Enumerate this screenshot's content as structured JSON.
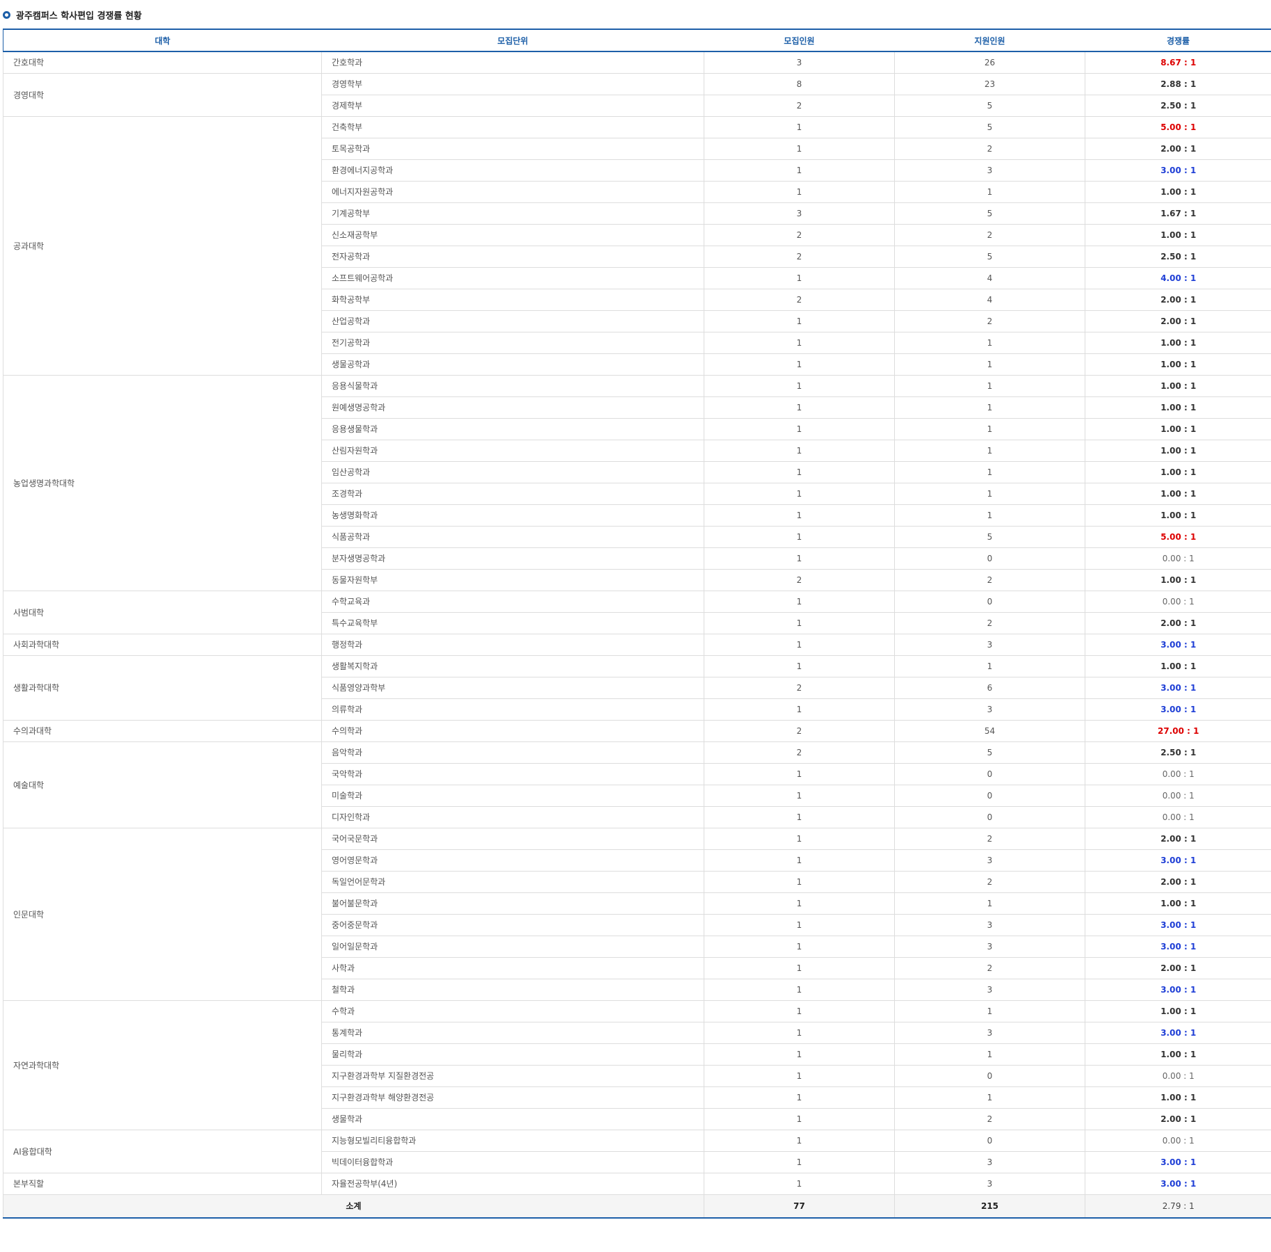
{
  "title": "광주캠퍼스 학사편입 경쟁률 현황",
  "headers": [
    "대학",
    "모집단위",
    "모집인원",
    "지원인원",
    "경쟁률"
  ],
  "colors": {
    "accent": "#1d5fa8",
    "high": "#dd0000",
    "mid": "#1f3fd6"
  },
  "groups": [
    {
      "college": "간호대학",
      "rows": [
        {
          "unit": "간호학과",
          "quota": "3",
          "applicants": "26",
          "rate": "8.67 : 1",
          "tone": "red"
        }
      ]
    },
    {
      "college": "경영대학",
      "rows": [
        {
          "unit": "경영학부",
          "quota": "8",
          "applicants": "23",
          "rate": "2.88 : 1",
          "tone": "normal"
        },
        {
          "unit": "경제학부",
          "quota": "2",
          "applicants": "5",
          "rate": "2.50 : 1",
          "tone": "normal"
        }
      ]
    },
    {
      "college": "공과대학",
      "rows": [
        {
          "unit": "건축학부",
          "quota": "1",
          "applicants": "5",
          "rate": "5.00 : 1",
          "tone": "red"
        },
        {
          "unit": "토목공학과",
          "quota": "1",
          "applicants": "2",
          "rate": "2.00 : 1",
          "tone": "normal"
        },
        {
          "unit": "환경에너지공학과",
          "quota": "1",
          "applicants": "3",
          "rate": "3.00 : 1",
          "tone": "blue"
        },
        {
          "unit": "에너지자원공학과",
          "quota": "1",
          "applicants": "1",
          "rate": "1.00 : 1",
          "tone": "normal"
        },
        {
          "unit": "기계공학부",
          "quota": "3",
          "applicants": "5",
          "rate": "1.67 : 1",
          "tone": "normal"
        },
        {
          "unit": "신소재공학부",
          "quota": "2",
          "applicants": "2",
          "rate": "1.00 : 1",
          "tone": "normal"
        },
        {
          "unit": "전자공학과",
          "quota": "2",
          "applicants": "5",
          "rate": "2.50 : 1",
          "tone": "normal"
        },
        {
          "unit": "소프트웨어공학과",
          "quota": "1",
          "applicants": "4",
          "rate": "4.00 : 1",
          "tone": "blue"
        },
        {
          "unit": "화학공학부",
          "quota": "2",
          "applicants": "4",
          "rate": "2.00 : 1",
          "tone": "normal"
        },
        {
          "unit": "산업공학과",
          "quota": "1",
          "applicants": "2",
          "rate": "2.00 : 1",
          "tone": "normal"
        },
        {
          "unit": "전기공학과",
          "quota": "1",
          "applicants": "1",
          "rate": "1.00 : 1",
          "tone": "normal"
        },
        {
          "unit": "생물공학과",
          "quota": "1",
          "applicants": "1",
          "rate": "1.00 : 1",
          "tone": "normal"
        }
      ]
    },
    {
      "college": "농업생명과학대학",
      "rows": [
        {
          "unit": "응용식물학과",
          "quota": "1",
          "applicants": "1",
          "rate": "1.00 : 1",
          "tone": "normal"
        },
        {
          "unit": "원예생명공학과",
          "quota": "1",
          "applicants": "1",
          "rate": "1.00 : 1",
          "tone": "normal"
        },
        {
          "unit": "응용생물학과",
          "quota": "1",
          "applicants": "1",
          "rate": "1.00 : 1",
          "tone": "normal"
        },
        {
          "unit": "산림자원학과",
          "quota": "1",
          "applicants": "1",
          "rate": "1.00 : 1",
          "tone": "normal"
        },
        {
          "unit": "임산공학과",
          "quota": "1",
          "applicants": "1",
          "rate": "1.00 : 1",
          "tone": "normal"
        },
        {
          "unit": "조경학과",
          "quota": "1",
          "applicants": "1",
          "rate": "1.00 : 1",
          "tone": "normal"
        },
        {
          "unit": "농생명화학과",
          "quota": "1",
          "applicants": "1",
          "rate": "1.00 : 1",
          "tone": "normal"
        },
        {
          "unit": "식품공학과",
          "quota": "1",
          "applicants": "5",
          "rate": "5.00 : 1",
          "tone": "red"
        },
        {
          "unit": "분자생명공학과",
          "quota": "1",
          "applicants": "0",
          "rate": "0.00 : 1",
          "tone": "zero"
        },
        {
          "unit": "동물자원학부",
          "quota": "2",
          "applicants": "2",
          "rate": "1.00 : 1",
          "tone": "normal"
        }
      ]
    },
    {
      "college": "사범대학",
      "rows": [
        {
          "unit": "수학교육과",
          "quota": "1",
          "applicants": "0",
          "rate": "0.00 : 1",
          "tone": "zero"
        },
        {
          "unit": "특수교육학부",
          "quota": "1",
          "applicants": "2",
          "rate": "2.00 : 1",
          "tone": "normal"
        }
      ]
    },
    {
      "college": "사회과학대학",
      "rows": [
        {
          "unit": "행정학과",
          "quota": "1",
          "applicants": "3",
          "rate": "3.00 : 1",
          "tone": "blue"
        }
      ]
    },
    {
      "college": "생활과학대학",
      "rows": [
        {
          "unit": "생활복지학과",
          "quota": "1",
          "applicants": "1",
          "rate": "1.00 : 1",
          "tone": "normal"
        },
        {
          "unit": "식품영양과학부",
          "quota": "2",
          "applicants": "6",
          "rate": "3.00 : 1",
          "tone": "blue"
        },
        {
          "unit": "의류학과",
          "quota": "1",
          "applicants": "3",
          "rate": "3.00 : 1",
          "tone": "blue"
        }
      ]
    },
    {
      "college": "수의과대학",
      "rows": [
        {
          "unit": "수의학과",
          "quota": "2",
          "applicants": "54",
          "rate": "27.00 : 1",
          "tone": "red"
        }
      ]
    },
    {
      "college": "예술대학",
      "rows": [
        {
          "unit": "음악학과",
          "quota": "2",
          "applicants": "5",
          "rate": "2.50 : 1",
          "tone": "normal"
        },
        {
          "unit": "국악학과",
          "quota": "1",
          "applicants": "0",
          "rate": "0.00 : 1",
          "tone": "zero"
        },
        {
          "unit": "미술학과",
          "quota": "1",
          "applicants": "0",
          "rate": "0.00 : 1",
          "tone": "zero"
        },
        {
          "unit": "디자인학과",
          "quota": "1",
          "applicants": "0",
          "rate": "0.00 : 1",
          "tone": "zero"
        }
      ]
    },
    {
      "college": "인문대학",
      "rows": [
        {
          "unit": "국어국문학과",
          "quota": "1",
          "applicants": "2",
          "rate": "2.00 : 1",
          "tone": "normal"
        },
        {
          "unit": "영어영문학과",
          "quota": "1",
          "applicants": "3",
          "rate": "3.00 : 1",
          "tone": "blue"
        },
        {
          "unit": "독일언어문학과",
          "quota": "1",
          "applicants": "2",
          "rate": "2.00 : 1",
          "tone": "normal"
        },
        {
          "unit": "불어불문학과",
          "quota": "1",
          "applicants": "1",
          "rate": "1.00 : 1",
          "tone": "normal"
        },
        {
          "unit": "중어중문학과",
          "quota": "1",
          "applicants": "3",
          "rate": "3.00 : 1",
          "tone": "blue"
        },
        {
          "unit": "일어일문학과",
          "quota": "1",
          "applicants": "3",
          "rate": "3.00 : 1",
          "tone": "blue"
        },
        {
          "unit": "사학과",
          "quota": "1",
          "applicants": "2",
          "rate": "2.00 : 1",
          "tone": "normal"
        },
        {
          "unit": "철학과",
          "quota": "1",
          "applicants": "3",
          "rate": "3.00 : 1",
          "tone": "blue"
        }
      ]
    },
    {
      "college": "자연과학대학",
      "rows": [
        {
          "unit": "수학과",
          "quota": "1",
          "applicants": "1",
          "rate": "1.00 : 1",
          "tone": "normal"
        },
        {
          "unit": "통계학과",
          "quota": "1",
          "applicants": "3",
          "rate": "3.00 : 1",
          "tone": "blue"
        },
        {
          "unit": "물리학과",
          "quota": "1",
          "applicants": "1",
          "rate": "1.00 : 1",
          "tone": "normal"
        },
        {
          "unit": "지구환경과학부 지질환경전공",
          "quota": "1",
          "applicants": "0",
          "rate": "0.00 : 1",
          "tone": "zero"
        },
        {
          "unit": "지구환경과학부 해양환경전공",
          "quota": "1",
          "applicants": "1",
          "rate": "1.00 : 1",
          "tone": "normal"
        },
        {
          "unit": "생물학과",
          "quota": "1",
          "applicants": "2",
          "rate": "2.00 : 1",
          "tone": "normal"
        }
      ]
    },
    {
      "college": "AI융합대학",
      "rows": [
        {
          "unit": "지능형모빌리티융합학과",
          "quota": "1",
          "applicants": "0",
          "rate": "0.00 : 1",
          "tone": "zero"
        },
        {
          "unit": "빅데이터융합학과",
          "quota": "1",
          "applicants": "3",
          "rate": "3.00 : 1",
          "tone": "blue"
        }
      ]
    },
    {
      "college": "본부직할",
      "rows": [
        {
          "unit": "자율전공학부(4년)",
          "quota": "1",
          "applicants": "3",
          "rate": "3.00 : 1",
          "tone": "blue"
        }
      ]
    }
  ],
  "total": {
    "label": "소계",
    "quota": "77",
    "applicants": "215",
    "rate": "2.79 : 1"
  }
}
